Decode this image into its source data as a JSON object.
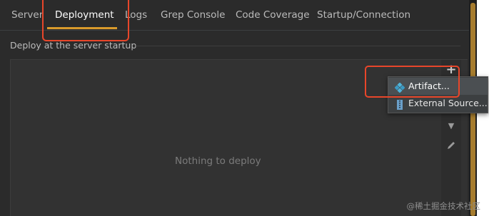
{
  "tabs": [
    {
      "label": "Server",
      "active": false
    },
    {
      "label": "Deployment",
      "active": true
    },
    {
      "label": "Logs",
      "active": false
    },
    {
      "label": "Grep Console",
      "active": false
    },
    {
      "label": "Code Coverage",
      "active": false
    },
    {
      "label": "Startup/Connection",
      "active": false
    }
  ],
  "section": {
    "title": "Deploy at the server startup",
    "empty_text": "Nothing to deploy"
  },
  "toolbar": {
    "add_icon": "plus-icon",
    "move_down_icon": "arrow-down-icon",
    "edit_icon": "pencil-icon"
  },
  "popup_menu": {
    "items": [
      {
        "label": "Artifact...",
        "icon": "artifact-icon",
        "selected": true
      },
      {
        "label": "External Source...",
        "icon": "archive-icon",
        "selected": false
      }
    ]
  },
  "watermark": "@稀土掘金技术社区",
  "colors": {
    "background": "#2b2b2b",
    "active_tab_underline": "#d99a2b",
    "annotation": "#e8462a",
    "scrollbar_thumb": "#a67c2e"
  }
}
